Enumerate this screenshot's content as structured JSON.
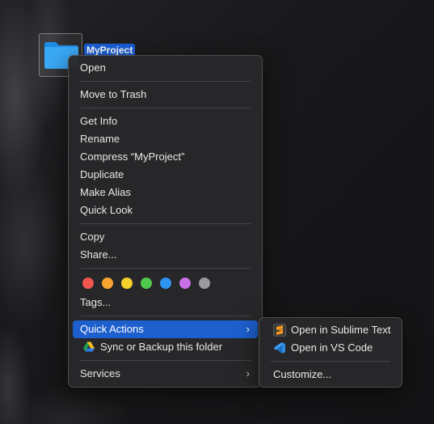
{
  "desktop": {
    "folder_name": "MyProject"
  },
  "context_menu": {
    "group1": [
      "Open"
    ],
    "group2": [
      "Move to Trash"
    ],
    "group3": [
      "Get Info",
      "Rename",
      "Compress “MyProject”",
      "Duplicate",
      "Make Alias",
      "Quick Look"
    ],
    "group4": [
      "Copy",
      "Share..."
    ],
    "tags": {
      "colors": [
        "#f2564e",
        "#f7a531",
        "#f4d12d",
        "#4fc94e",
        "#2e93f1",
        "#c770e8",
        "#9a9a9c"
      ],
      "label": "Tags..."
    },
    "quick_actions": "Quick Actions",
    "sync_backup": "Sync or Backup this folder",
    "services": "Services",
    "chevron": "›"
  },
  "quick_actions_submenu": {
    "items": [
      "Open in Sublime Text",
      "Open in VS Code"
    ],
    "customize": "Customize..."
  },
  "colors": {
    "highlight": "#1d5fcc",
    "folder_label_bg": "#1a5fd6"
  }
}
